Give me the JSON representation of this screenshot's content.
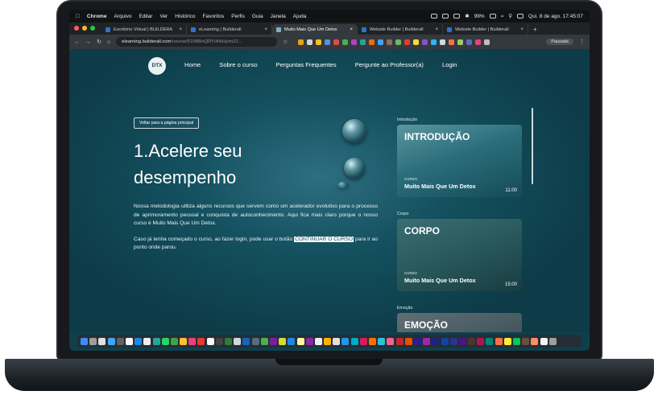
{
  "menubar": {
    "app": "Chrome",
    "items": [
      "Arquivo",
      "Editar",
      "Ver",
      "Histórico",
      "Favoritos",
      "Perfis",
      "Guia",
      "Janela",
      "Ajuda"
    ],
    "battery": "99%",
    "datetime": "Qui. 8 de ago. 17:45:07"
  },
  "tabs": [
    {
      "label": "Escritório Virtual | BUILDERA",
      "active": false
    },
    {
      "label": "eLearning | Builderall",
      "active": false
    },
    {
      "label": "Muito Mais Que Um Detox",
      "active": true
    },
    {
      "label": "Website Builder | Builderall",
      "active": false
    },
    {
      "label": "Website Builder | Builderall",
      "active": false
    }
  ],
  "address": {
    "host": "elearning.builderall.com",
    "path": "/course/51988/xQRY/ANHy/m22...",
    "profile": "Pausada"
  },
  "site": {
    "logo": "DTX",
    "nav": [
      "Home",
      "Sobre o curso",
      "Perguntas Frequentes",
      "Pergunte ao Professor(a)",
      "Login"
    ],
    "back_button": "Voltar para a página principal",
    "title": "1.Acelere seu desempenho",
    "paragraph1": "Nossa metodologia utiliza alguns recursos que servem como um acelerador evolutivo para o processo de aprimoramento pessoal e conquista de autoconhecimento. Aqui fica mais claro porque o nosso curso é Muito Mais Que Um Detox.",
    "paragraph2_pre": "Caso já tenha começado o curso, ao fazer login, pode usar o botão ",
    "paragraph2_highlight": "CONTINUAR O CURSO",
    "paragraph2_post": " para ir ao ponto onde parou."
  },
  "sidebar": {
    "sections": [
      {
        "label": "Introdução",
        "card_title": "INTRODUÇÃO",
        "card_kicker": "CURSO",
        "card_name": "Muito Mais Que Um Detox",
        "duration": "11:00"
      },
      {
        "label": "Corpo",
        "card_title": "CORPO",
        "card_kicker": "CURSO",
        "card_name": "Muito Mais Que Um Detox",
        "duration": "15:00"
      },
      {
        "label": "Emoção",
        "card_title": "EMOÇÃO",
        "card_kicker": "",
        "card_name": "",
        "duration": ""
      }
    ]
  },
  "colors": {
    "page_bg": "#0f3f4c",
    "accent": "#ffffff"
  }
}
